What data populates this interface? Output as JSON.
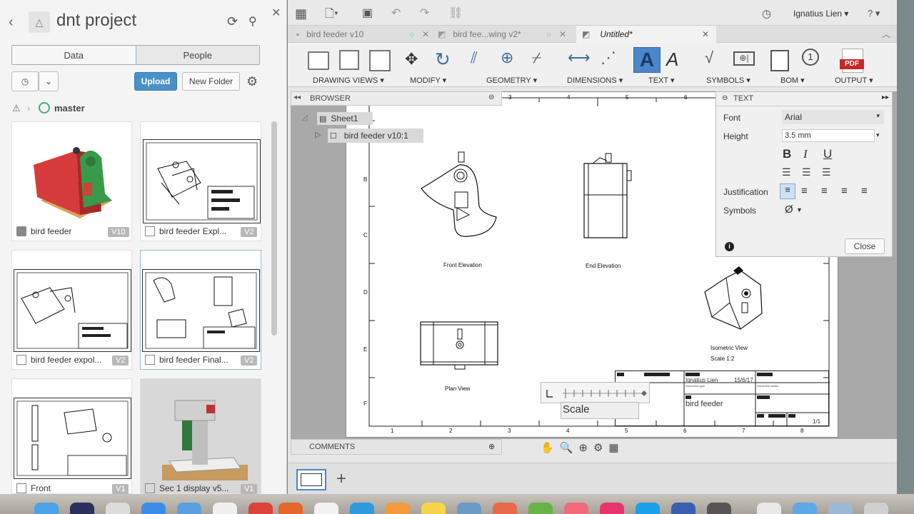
{
  "left_panel": {
    "back_icon": "chevron-left-icon",
    "project_title": "dnt project",
    "tabs": [
      "Data",
      "People"
    ],
    "upload_label": "Upload",
    "new_folder_label": "New Folder",
    "breadcrumb": "master",
    "files": [
      {
        "name": "bird feeder",
        "version": "V10"
      },
      {
        "name": "bird feeder Expl...",
        "version": "V2"
      },
      {
        "name": "bird feeder expol...",
        "version": "V2"
      },
      {
        "name": "bird feeder Final...",
        "version": "V2"
      },
      {
        "name": "Front",
        "version": "V1"
      },
      {
        "name": "Sec 1 display v5...",
        "version": "V1"
      }
    ]
  },
  "topbar": {
    "user": "Ignatius Lien ▾",
    "help": "? ▾"
  },
  "tabs": [
    {
      "label": "bird feeder v10"
    },
    {
      "label": "bird fee...wing v2*"
    },
    {
      "label": "Untitled*"
    }
  ],
  "ribbon": {
    "groups": [
      "DRAWING VIEWS ▾",
      "MODIFY ▾",
      "GEOMETRY ▾",
      "DIMENSIONS ▾",
      "TEXT ▾",
      "SYMBOLS ▾",
      "BOM ▾",
      "OUTPUT ▾"
    ],
    "pdf_label": "PDF"
  },
  "browser": {
    "title": "BROWSER",
    "sheet": "Sheet1",
    "item": "bird feeder v10:1"
  },
  "drawing": {
    "front_caption": "Front Elevation",
    "end_caption": "End Elevation",
    "plan_caption": "Plan View",
    "iso_caption": "Isometric View",
    "iso_scale": "Scale 1:2",
    "title_author": "Ignatius Lien",
    "title_date": "15/6/17",
    "title_name": "bird feeder",
    "title_sheet": "1/1",
    "scale_label": "Scale",
    "col_nums": [
      "3",
      "4",
      "5",
      "6",
      "7",
      "1",
      "2",
      "3",
      "4",
      "5",
      "6",
      "7",
      "8"
    ],
    "row_letters": [
      "B",
      "C",
      "D",
      "E",
      "F"
    ],
    "doc_type": "Document type",
    "doc_status": "Document status"
  },
  "text_panel": {
    "title": "TEXT",
    "font_label": "Font",
    "font_value": "Arial",
    "height_label": "Height",
    "height_value": "3.5 mm",
    "justification_label": "Justification",
    "symbols_label": "Symbols",
    "symbol_value": "Ø",
    "bold": "B",
    "italic": "I",
    "underline": "U",
    "close_label": "Close"
  },
  "comments": {
    "title": "COMMENTS"
  }
}
